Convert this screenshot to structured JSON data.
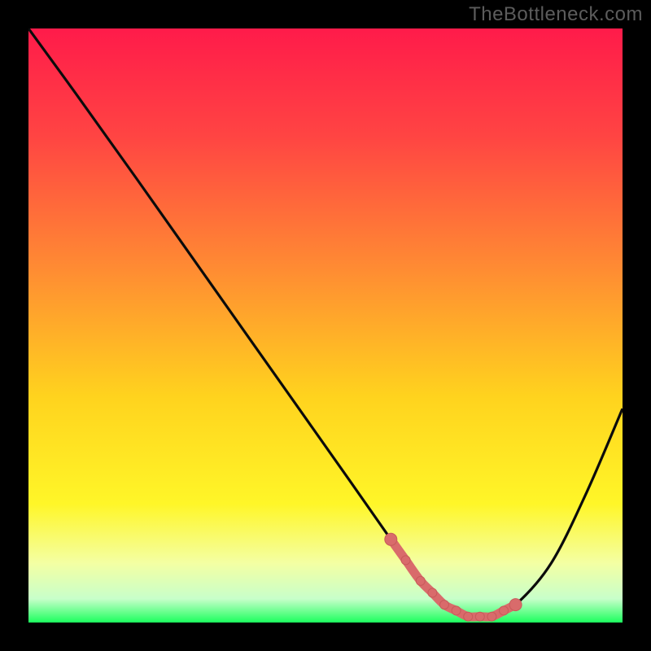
{
  "watermark": "TheBottleneck.com",
  "colors": {
    "bg": "#000000",
    "curve": "#0b0b0b",
    "marker_fill": "#d96b6b",
    "marker_stroke": "#c85a5a",
    "watermark": "#5c5c5c"
  },
  "chart_data": {
    "type": "line",
    "title": "",
    "xlabel": "",
    "ylabel": "",
    "xlim": [
      0,
      100
    ],
    "ylim": [
      0,
      100
    ],
    "gradient_stops": [
      {
        "offset": 0,
        "color": "#ff1b4a"
      },
      {
        "offset": 18,
        "color": "#ff4443"
      },
      {
        "offset": 40,
        "color": "#ff8a33"
      },
      {
        "offset": 62,
        "color": "#ffd31e"
      },
      {
        "offset": 80,
        "color": "#fff628"
      },
      {
        "offset": 90,
        "color": "#f4ffa3"
      },
      {
        "offset": 96,
        "color": "#c8ffca"
      },
      {
        "offset": 100,
        "color": "#1cff5e"
      }
    ],
    "series": [
      {
        "name": "bottleneck-curve",
        "x": [
          0,
          8,
          18,
          30,
          42,
          54,
          61,
          66,
          70,
          74,
          78,
          82,
          88,
          94,
          100
        ],
        "values": [
          100,
          89,
          75,
          58,
          41,
          24,
          14,
          7,
          3,
          1,
          1,
          3,
          10,
          22,
          36
        ]
      }
    ],
    "flat_region": {
      "x_start": 61,
      "x_end": 82
    },
    "marker_positions": [
      {
        "x": 61.0,
        "y": 14.0
      },
      {
        "x": 63.5,
        "y": 10.5
      },
      {
        "x": 66.0,
        "y": 7.0
      },
      {
        "x": 68.0,
        "y": 5.0
      },
      {
        "x": 70.0,
        "y": 3.0
      },
      {
        "x": 72.0,
        "y": 2.0
      },
      {
        "x": 74.0,
        "y": 1.0
      },
      {
        "x": 76.0,
        "y": 1.0
      },
      {
        "x": 78.0,
        "y": 1.0
      },
      {
        "x": 80.0,
        "y": 2.0
      },
      {
        "x": 82.0,
        "y": 3.0
      }
    ]
  }
}
